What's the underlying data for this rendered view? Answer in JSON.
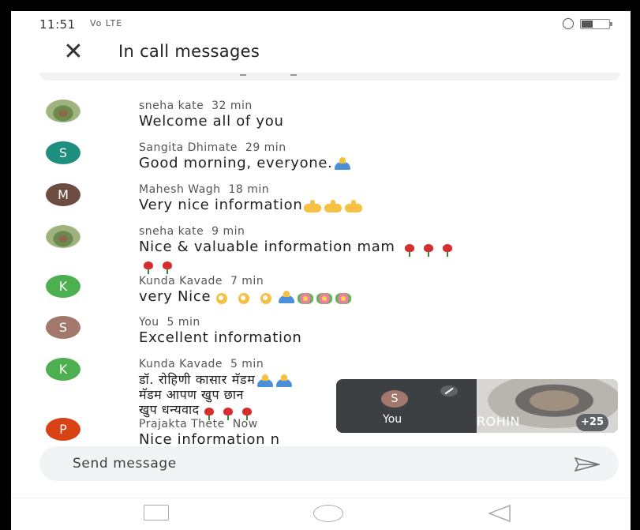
{
  "status_bar": {
    "time": "11:51",
    "signal_text": "Vo LTE"
  },
  "header": {
    "close_icon": "close-icon",
    "title": "In call messages"
  },
  "messages": [
    {
      "sender": "sneha kate",
      "time": "32 min",
      "text": "Welcome all of you",
      "avatar": "photo",
      "avatar_letter": ""
    },
    {
      "sender": "Sangita Dhimate",
      "time": "29 min",
      "text": "Good morning, everyone.",
      "avatar": "letter",
      "avatar_letter": "S",
      "avatar_color": "#1e8e7e"
    },
    {
      "sender": "Mahesh Wagh",
      "time": "18 min",
      "text": "Very nice information",
      "avatar": "letter",
      "avatar_letter": "M",
      "avatar_color": "#6d4c41"
    },
    {
      "sender": "sneha kate",
      "time": "9 min",
      "text": "Nice & valuable information mam",
      "avatar": "photo",
      "avatar_letter": ""
    },
    {
      "sender": "Kunda Kavade",
      "time": "7 min",
      "text": "very Nice",
      "avatar": "letter",
      "avatar_letter": "K",
      "avatar_color": "#4caf50"
    },
    {
      "sender": "You",
      "time": "5 min",
      "text": "Excellent information",
      "avatar": "letter",
      "avatar_letter": "S",
      "avatar_color": "#a1786b"
    },
    {
      "sender": "Kunda Kavade",
      "time": "5 min",
      "text": "डॉ. रोहिणी कासार मॅडम",
      "line2": "मॅडम आपण खुप छान",
      "line3": "खुप धन्यवाद",
      "avatar": "letter",
      "avatar_letter": "K",
      "avatar_color": "#4caf50"
    },
    {
      "sender": "Prajakta Thete",
      "time": "Now",
      "text": "Nice information n",
      "avatar": "letter",
      "avatar_letter": "P",
      "avatar_color": "#d84315"
    }
  ],
  "call_overlay": {
    "self_letter": "S",
    "self_label": "You",
    "remote_name": "ROHIN",
    "participants_badge": "+25"
  },
  "composer": {
    "placeholder": "Send message"
  },
  "colors": {
    "accent": "#1e8e7e",
    "bubble_bg": "#f1f3f4",
    "overlay_bg": "#3c4043"
  }
}
